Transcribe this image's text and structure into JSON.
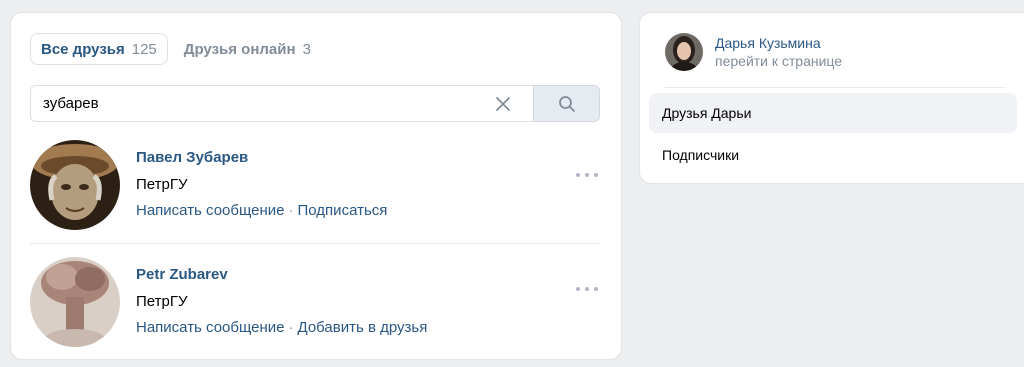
{
  "tabs": [
    {
      "label": "Все друзья",
      "count": "125"
    },
    {
      "label": "Друзья онлайн",
      "count": "3"
    }
  ],
  "search": {
    "value": "зубарев"
  },
  "results": [
    {
      "name": "Павел Зубарев",
      "subtitle": "ПетрГУ",
      "action1": "Написать сообщение",
      "action2": "Подписаться"
    },
    {
      "name": "Petr Zubarev",
      "subtitle": "ПетрГУ",
      "action1": "Написать сообщение",
      "action2": "Добавить в друзья"
    }
  ],
  "sidebar": {
    "owner_name": "Дарья Кузьмина",
    "owner_link": "перейти к странице",
    "items": [
      {
        "label": "Друзья Дарьи"
      },
      {
        "label": "Подписчики"
      }
    ]
  },
  "colors": {
    "link": "#2a5885",
    "muted": "#818c99",
    "background": "#edeef0"
  },
  "icons": [
    "clear-icon",
    "search-icon",
    "more-icon"
  ]
}
